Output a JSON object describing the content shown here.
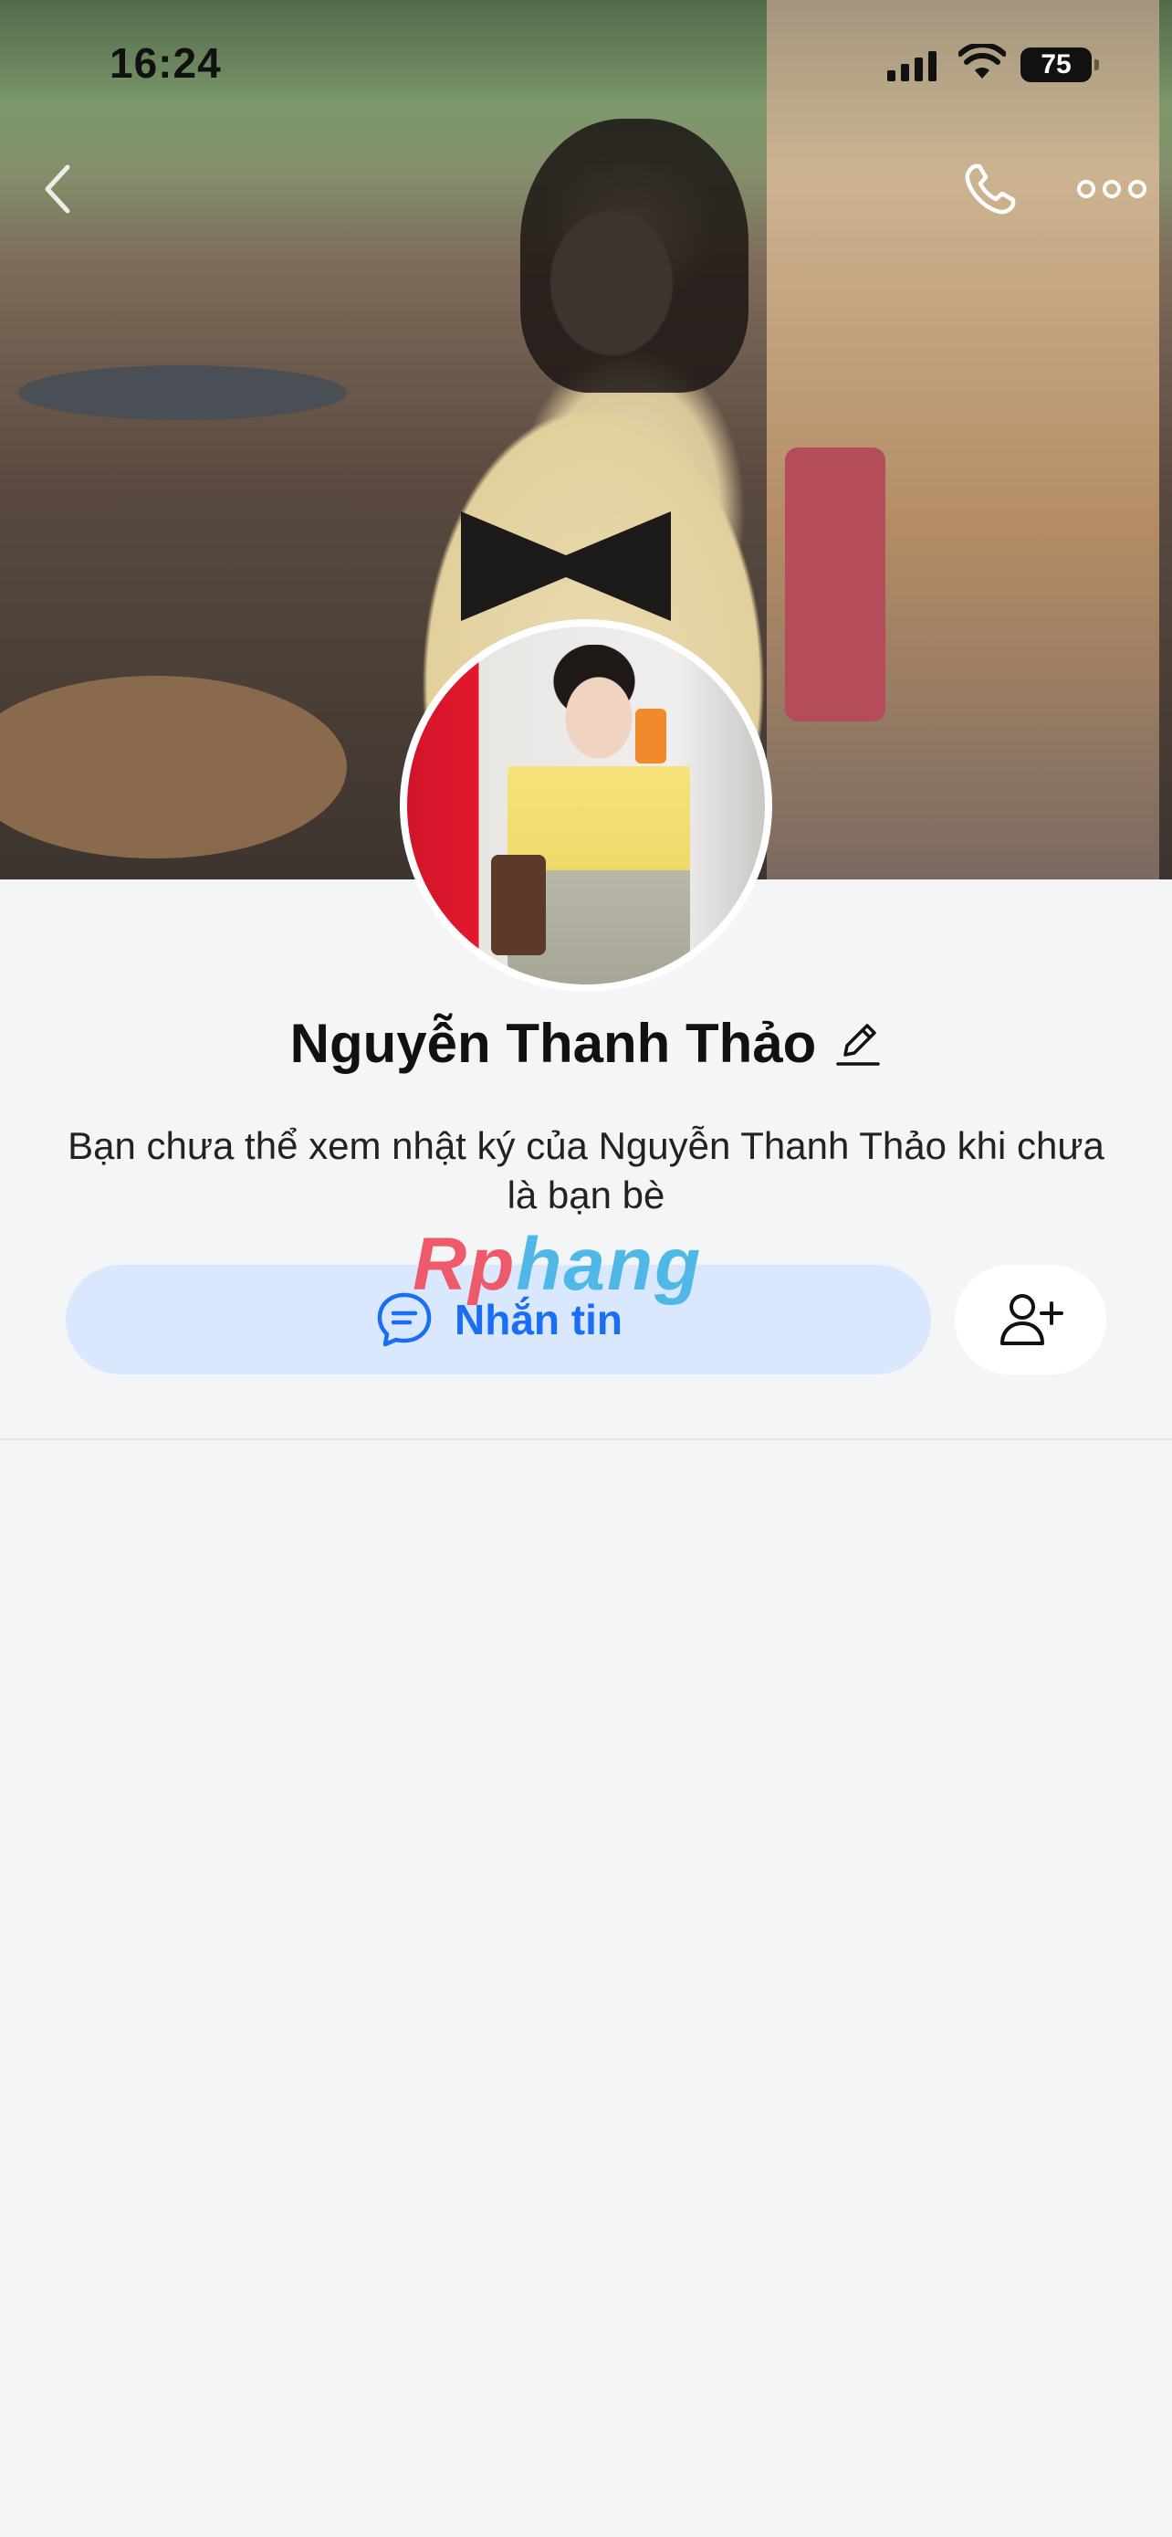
{
  "status_bar": {
    "time": "16:24",
    "battery": "75",
    "icons": [
      "cellular-signal-icon",
      "wifi-icon",
      "battery-icon"
    ]
  },
  "top_bar": {
    "icons": [
      "back-icon",
      "phone-call-icon",
      "more-options-icon"
    ]
  },
  "profile": {
    "name": "Nguyễn Thanh Thảo",
    "privacy_notice": "Bạn chưa thể xem nhật ký của Nguyễn Thanh Thảo khi chưa là bạn bè"
  },
  "actions": {
    "message_label": "Nhắn tin",
    "message_icon": "chat-bubble-icon",
    "add_friend_icon": "add-friend-icon"
  },
  "watermark": {
    "part1": "Rp",
    "part2": "hang"
  },
  "colors": {
    "accent": "#1a6ef5",
    "message_button_bg": "#d9e8ff",
    "page_bg": "#f4f5f7"
  }
}
